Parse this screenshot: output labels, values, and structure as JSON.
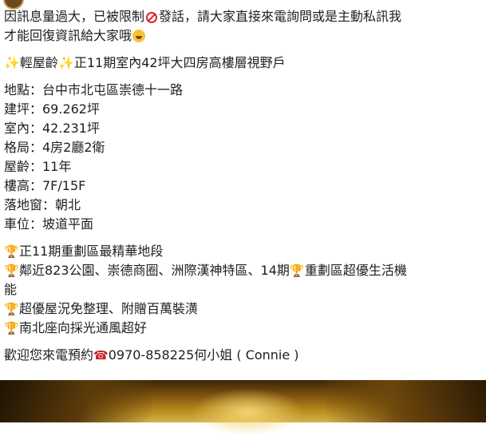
{
  "post": {
    "notice_part1": "因訊息量過大，已被限制",
    "notice_part2": "發話，請大家直接來電詢問或是主動私訊我",
    "notice_line2": "才能回復資訊給大家哦",
    "headline": "輕屋齡",
    "headline_rest": "正11期室內42坪大四房高樓層視野戶",
    "details": [
      "地點：台中市北屯區崇德十一路",
      "建坪：69.262坪",
      "室內：42.231坪",
      "格局：4房2廳2衛",
      "屋齡：11年",
      "樓高：7F/15F",
      "落地窗：朝北",
      "車位：坡道平面"
    ],
    "highlights": {
      "h1": "正11期重劃區最精華地段",
      "h2_part1": "鄰近823公園、崇德商圈、洲際漢神特區、14期",
      "h2_part2": "重劃區超優生活機",
      "h2_wrap": "能",
      "h3": "超優屋況免整理、附贈百萬裝潢",
      "h4": "南北座向採光通風超好"
    },
    "contact_part1": "歡迎您來電預約",
    "contact_part2": "0970-858225何小姐 ( Connie )"
  },
  "icons": {
    "sparkle": "✨",
    "trophy": "🏆",
    "phone": "☎",
    "no_entry": "no-entry-icon",
    "smile": "smiling-face-icon"
  }
}
